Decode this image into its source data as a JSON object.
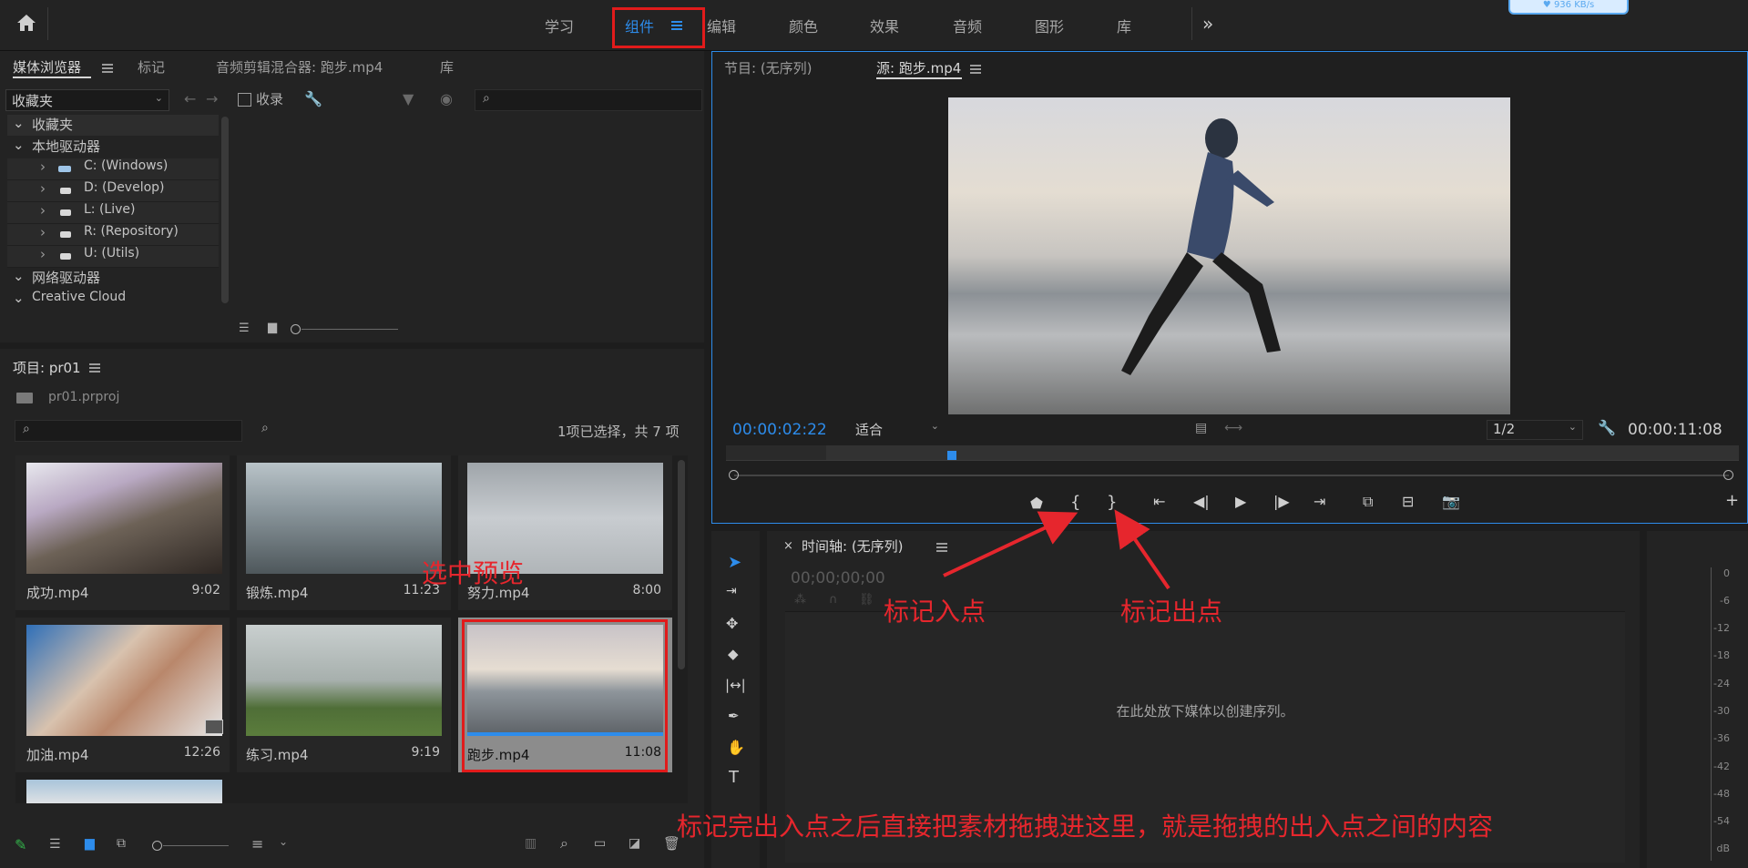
{
  "workspace": {
    "tabs": [
      "学习",
      "组件",
      "编辑",
      "颜色",
      "效果",
      "音频",
      "图形",
      "库"
    ],
    "active": "组件",
    "overflow_icon": "double-chevron-right-icon",
    "badge_text": "♥ 936 KB/s"
  },
  "media_browser": {
    "tabs": [
      "媒体浏览器",
      "标记",
      "音频剪辑混合器: 跑步.mp4",
      "库"
    ],
    "location_select": "收藏夹",
    "ingest_label": "收录",
    "tree": [
      {
        "label": "收藏夹",
        "level": 0
      },
      {
        "label": "本地驱动器",
        "level": 0
      },
      {
        "label": "C: (Windows)",
        "level": 1
      },
      {
        "label": "D: (Develop)",
        "level": 1
      },
      {
        "label": "L: (Live)",
        "level": 1
      },
      {
        "label": "R: (Repository)",
        "level": 1
      },
      {
        "label": "U: (Utils)",
        "level": 1
      },
      {
        "label": "网络驱动器",
        "level": 0
      },
      {
        "label": "Creative Cloud",
        "level": 0
      }
    ]
  },
  "project": {
    "title": "项目: pr01",
    "file": "pr01.prproj",
    "selection_status": "1项已选择，共 7 项",
    "clips": [
      {
        "name": "成功.mp4",
        "duration": "9:02"
      },
      {
        "name": "锻炼.mp4",
        "duration": "11:23"
      },
      {
        "name": "努力.mp4",
        "duration": "8:00"
      },
      {
        "name": "加油.mp4",
        "duration": "12:26"
      },
      {
        "name": "练习.mp4",
        "duration": "9:19"
      },
      {
        "name": "跑步.mp4",
        "duration": "11:08"
      }
    ]
  },
  "source_monitor": {
    "tab_program": "节目: (无序列)",
    "tab_source": "源: 跑步.mp4",
    "current_timecode": "00:00:02:22",
    "fit_select": "适合",
    "resolution_select": "1/2",
    "duration_timecode": "00:00:11:08",
    "playhead_fraction": 0.25
  },
  "timeline": {
    "title": "时间轴: (无序列)",
    "timecode": "00;00;00;00",
    "drop_hint": "在此处放下媒体以创建序列。"
  },
  "audio_meter": {
    "db_labels": [
      "0",
      "-6",
      "-12",
      "-18",
      "-24",
      "-30",
      "-36",
      "-42",
      "-48",
      "-54",
      "dB"
    ]
  },
  "annotations": {
    "preview_label": "选中预览",
    "mark_in_label": "标记入点",
    "mark_out_label": "标记出点",
    "drag_instruction": "标记完出入点之后直接把素材拖拽进这里，就是拖拽的出入点之间的内容"
  },
  "colors": {
    "accent_blue": "#2d8ceb",
    "annotation_red": "#e6262d",
    "panel_bg": "#232323",
    "app_bg": "#1d1d1d"
  }
}
